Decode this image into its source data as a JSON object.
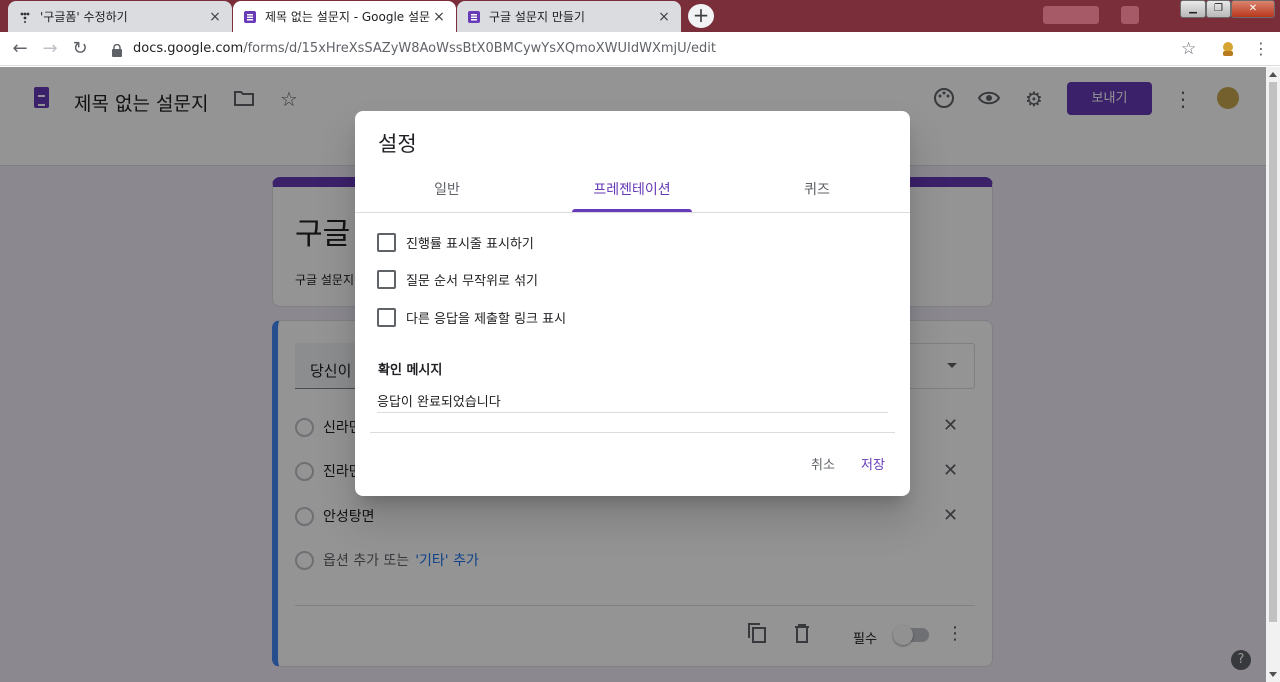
{
  "browser": {
    "tabs": [
      {
        "title": "'구글폼' 수정하기",
        "active": false
      },
      {
        "title": "제목 없는 설문지 - Google 설문",
        "active": true
      },
      {
        "title": "구글 설문지 만들기",
        "active": false
      }
    ],
    "new_tab_label": "+",
    "close_glyph": "×",
    "url_host": "docs.google.com",
    "url_path": "/forms/d/15xHreXsSAZyW8AoWssBtX0BMCywYsXQmoXWUIdWXmjU/edit"
  },
  "header": {
    "form_name": "제목 없는 설문지",
    "send_label": "보내기",
    "accent_color": "#673ab7"
  },
  "form": {
    "title": "구글",
    "description": "구글 설문지",
    "question_title": "당신이",
    "options": [
      "신라면",
      "진라면",
      "안성탕면"
    ],
    "add_option": "옵션 추가 또는",
    "add_other": "'기타' 추가",
    "required_label": "필수"
  },
  "dialog": {
    "title": "설정",
    "tabs": [
      "일반",
      "프레젠테이션",
      "퀴즈"
    ],
    "active_tab": "프레젠테이션",
    "checkboxes": [
      {
        "label": "진행률 표시줄 표시하기",
        "checked": false
      },
      {
        "label": "질문 순서 무작위로 섞기",
        "checked": false
      },
      {
        "label": "다른 응답을 제출할 링크 표시",
        "checked": false
      }
    ],
    "confirm_label": "확인 메시지",
    "confirm_value": "응답이 완료되었습니다",
    "cancel_label": "취소",
    "save_label": "저장"
  },
  "help_label": "?"
}
